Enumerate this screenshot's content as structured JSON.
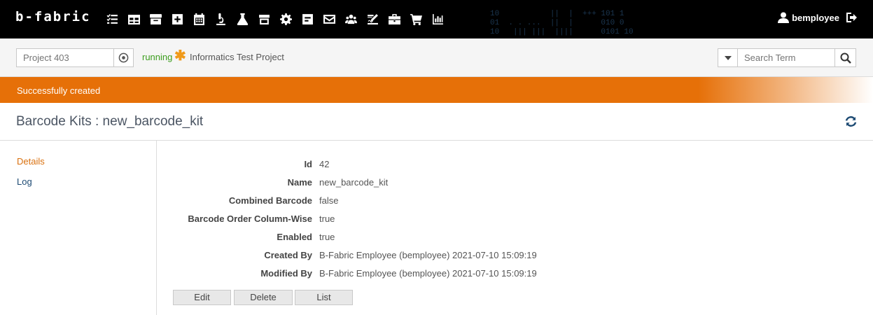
{
  "app": {
    "logo": "b-fabric"
  },
  "nav": {
    "icons": [
      "tasks-icon",
      "table-icon",
      "archive-icon",
      "plus-square-icon",
      "calendar-icon",
      "microscope-icon",
      "flask-icon",
      "store-icon",
      "gear-icon",
      "form-icon",
      "envelope-icon",
      "users-icon",
      "signature-icon",
      "toolbox-icon",
      "cart-icon",
      "chart-icon"
    ]
  },
  "user": {
    "name": "bemployee"
  },
  "project": {
    "placeholder": "Project 403",
    "status": "running",
    "status_color": "#3c9d1e",
    "name": "Informatics Test Project"
  },
  "search": {
    "placeholder": "Search Term"
  },
  "alert": {
    "message": "Successfully created",
    "color": "#e67008"
  },
  "page": {
    "title": "Barcode Kits : new_barcode_kit"
  },
  "sidebar": {
    "items": [
      {
        "label": "Details"
      },
      {
        "label": "Log"
      }
    ]
  },
  "details": [
    {
      "label": "Id",
      "value": "42"
    },
    {
      "label": "Name",
      "value": "new_barcode_kit"
    },
    {
      "label": "Combined Barcode",
      "value": "false"
    },
    {
      "label": "Barcode Order Column-Wise",
      "value": "true"
    },
    {
      "label": "Enabled",
      "value": "true"
    },
    {
      "label": "Created By",
      "value": "B-Fabric Employee (bemployee) 2021-07-10 15:09:19"
    },
    {
      "label": "Modified By",
      "value": "B-Fabric Employee (bemployee) 2021-07-10 15:09:19"
    }
  ],
  "actions": {
    "edit": "Edit",
    "delete": "Delete",
    "list": "List"
  }
}
